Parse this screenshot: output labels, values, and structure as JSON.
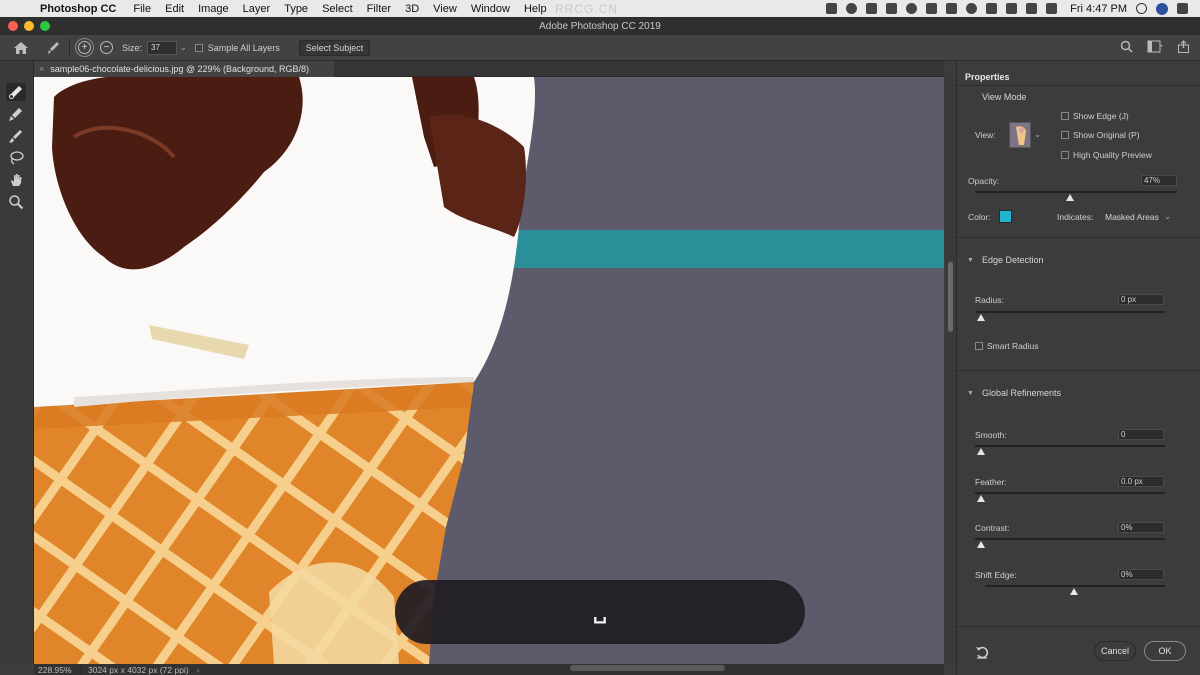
{
  "menubar": {
    "app": "Photoshop CC",
    "items": [
      "File",
      "Edit",
      "Image",
      "Layer",
      "Type",
      "Select",
      "Filter",
      "3D",
      "View",
      "Window",
      "Help"
    ],
    "clock": "Fri 4:47 PM",
    "watermark": "RRCG.CN"
  },
  "window": {
    "title": "Adobe Photoshop CC 2019"
  },
  "options_bar": {
    "size_label": "Size:",
    "size_value": "37",
    "sample_all_layers": "Sample All Layers",
    "select_subject": "Select Subject"
  },
  "document": {
    "tab_title": "sample06-chocolate-delicious.jpg @ 229% (Background, RGB/8)"
  },
  "hud": {
    "key_glyph": "␣"
  },
  "status": {
    "zoom": "228.95%",
    "dimensions": "3024 px x 4032 px (72 ppi)",
    "arrow": "›"
  },
  "properties": {
    "title": "Properties",
    "view_mode": {
      "heading": "View Mode",
      "view_label": "View:",
      "show_edge": "Show Edge (J)",
      "show_original": "Show Original (P)",
      "high_quality": "High Quality Preview",
      "opacity_label": "Opacity:",
      "opacity_value": "47%",
      "opacity_fraction": 0.47,
      "color_label": "Color:",
      "color_hex": "#1fb4cf",
      "indicates_label": "Indicates:",
      "indicates_value": "Masked Areas"
    },
    "edge_detection": {
      "heading": "Edge Detection",
      "radius_label": "Radius:",
      "radius_value": "0 px",
      "smart_radius": "Smart Radius"
    },
    "global_refinements": {
      "heading": "Global Refinements",
      "smooth_label": "Smooth:",
      "smooth_value": "0",
      "feather_label": "Feather:",
      "feather_value": "0.0 px",
      "contrast_label": "Contrast:",
      "contrast_value": "0%",
      "shift_edge_label": "Shift Edge:",
      "shift_edge_value": "0%"
    },
    "cancel_label": "Cancel",
    "ok_label": "OK"
  }
}
